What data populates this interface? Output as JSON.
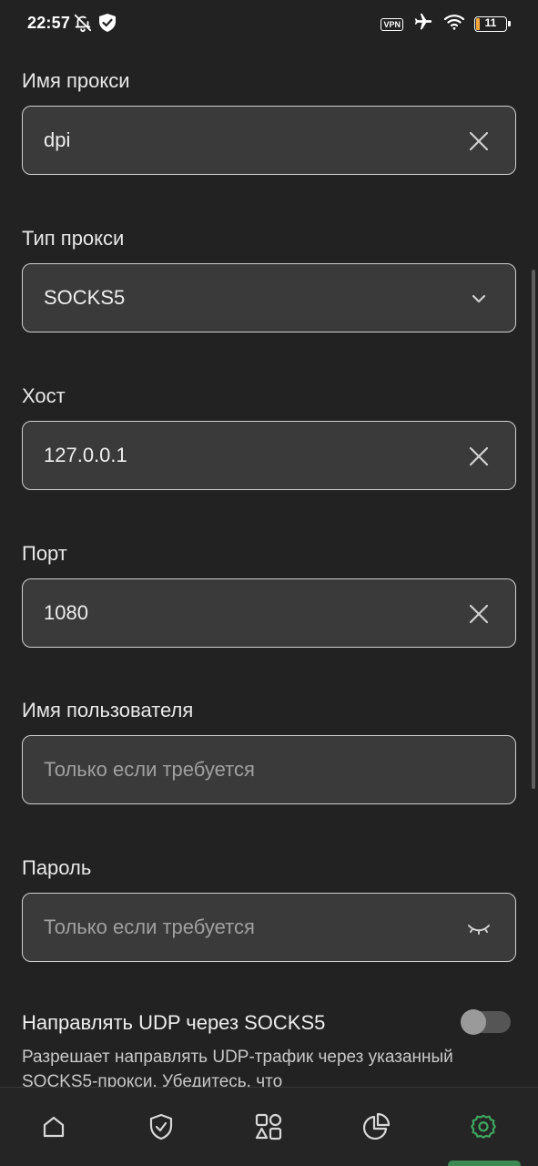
{
  "status_bar": {
    "time": "22:57",
    "icons_left": [
      "bell-off-icon",
      "shield-check-icon"
    ],
    "vpn_label": "VPN",
    "battery_level": "11",
    "battery_color": "#f2a53a",
    "icons_right": [
      "airplane-icon",
      "wifi-icon"
    ]
  },
  "form": {
    "proxy_name": {
      "label": "Имя прокси",
      "value": "dpi"
    },
    "proxy_type": {
      "label": "Тип прокси",
      "value": "SOCKS5"
    },
    "host": {
      "label": "Хост",
      "value": "127.0.0.1"
    },
    "port": {
      "label": "Порт",
      "value": "1080"
    },
    "username": {
      "label": "Имя пользователя",
      "placeholder": "Только если требуется",
      "value": ""
    },
    "password": {
      "label": "Пароль",
      "placeholder": "Только если требуется",
      "value": ""
    },
    "udp_toggle": {
      "title": "Направлять UDP через SOCKS5",
      "description": "Разрешает направлять UDP-трафик через указанный SOCKS5-прокси. Убедитесь, что",
      "enabled": false
    }
  },
  "bottom_nav": {
    "active_color": "#3fa45f",
    "items": [
      "home-icon",
      "shield-icon",
      "apps-icon",
      "stats-pie-icon",
      "settings-icon"
    ],
    "active_item": "settings-icon"
  }
}
